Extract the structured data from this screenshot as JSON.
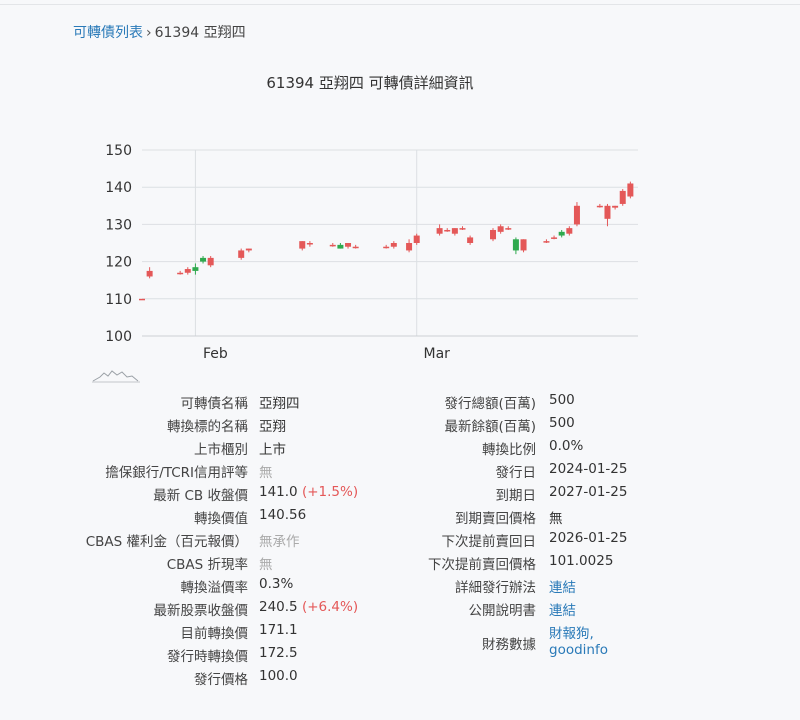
{
  "breadcrumb": {
    "parent": "可轉債列表",
    "separator": "›",
    "current": "61394 亞翔四"
  },
  "page_title": "61394 亞翔四 可轉債詳細資訊",
  "chart_data": {
    "type": "candlestick",
    "title": "",
    "ylim": [
      100,
      150
    ],
    "yticks": [
      "100",
      "110",
      "120",
      "130",
      "140",
      "150"
    ],
    "xtick_labels": [
      {
        "label": "Feb",
        "date": "2024-02-01"
      },
      {
        "label": "Mar",
        "date": "2024-03-01"
      }
    ],
    "x_range": [
      "2024-01-25",
      "2024-03-30"
    ],
    "colors": {
      "up": "#e45858",
      "down": "#2fa94e",
      "grid": "#dcdfe3"
    },
    "candles": [
      {
        "date": "2024-01-25",
        "o": 110.0,
        "h": 110.0,
        "l": 110.0,
        "c": 110.0
      },
      {
        "date": "2024-01-26",
        "o": 116.0,
        "h": 118.5,
        "l": 115.5,
        "c": 117.5
      },
      {
        "date": "2024-01-30",
        "o": 117.0,
        "h": 117.5,
        "l": 116.5,
        "c": 117.0
      },
      {
        "date": "2024-01-31",
        "o": 117.0,
        "h": 118.5,
        "l": 116.5,
        "c": 118.0
      },
      {
        "date": "2024-02-01",
        "o": 118.5,
        "h": 119.5,
        "l": 116.5,
        "c": 117.5
      },
      {
        "date": "2024-02-02",
        "o": 121.0,
        "h": 121.5,
        "l": 119.5,
        "c": 120.0
      },
      {
        "date": "2024-02-03",
        "o": 119.0,
        "h": 121.5,
        "l": 118.5,
        "c": 121.0
      },
      {
        "date": "2024-02-07",
        "o": 121.0,
        "h": 123.5,
        "l": 120.5,
        "c": 123.0
      },
      {
        "date": "2024-02-08",
        "o": 123.0,
        "h": 123.5,
        "l": 122.5,
        "c": 123.5
      },
      {
        "date": "2024-02-15",
        "o": 123.5,
        "h": 125.5,
        "l": 123.0,
        "c": 125.5
      },
      {
        "date": "2024-02-16",
        "o": 125.0,
        "h": 125.5,
        "l": 124.0,
        "c": 125.0
      },
      {
        "date": "2024-02-19",
        "o": 124.5,
        "h": 125.0,
        "l": 124.0,
        "c": 124.5
      },
      {
        "date": "2024-02-20",
        "o": 124.5,
        "h": 125.0,
        "l": 123.5,
        "c": 123.5
      },
      {
        "date": "2024-02-21",
        "o": 124.0,
        "h": 125.0,
        "l": 123.5,
        "c": 125.0
      },
      {
        "date": "2024-02-22",
        "o": 124.0,
        "h": 124.5,
        "l": 123.5,
        "c": 124.0
      },
      {
        "date": "2024-02-26",
        "o": 124.0,
        "h": 124.5,
        "l": 123.5,
        "c": 124.0
      },
      {
        "date": "2024-02-27",
        "o": 124.0,
        "h": 125.5,
        "l": 123.5,
        "c": 125.0
      },
      {
        "date": "2024-02-29",
        "o": 123.0,
        "h": 126.0,
        "l": 122.5,
        "c": 125.0
      },
      {
        "date": "2024-03-01",
        "o": 125.0,
        "h": 127.5,
        "l": 124.5,
        "c": 127.0
      },
      {
        "date": "2024-03-04",
        "o": 127.5,
        "h": 130.0,
        "l": 127.0,
        "c": 129.0
      },
      {
        "date": "2024-03-05",
        "o": 128.5,
        "h": 129.0,
        "l": 128.0,
        "c": 128.5
      },
      {
        "date": "2024-03-06",
        "o": 127.5,
        "h": 129.0,
        "l": 127.0,
        "c": 129.0
      },
      {
        "date": "2024-03-07",
        "o": 129.0,
        "h": 129.5,
        "l": 128.5,
        "c": 129.0
      },
      {
        "date": "2024-03-08",
        "o": 125.0,
        "h": 127.0,
        "l": 124.5,
        "c": 126.5
      },
      {
        "date": "2024-03-11",
        "o": 126.0,
        "h": 129.0,
        "l": 125.5,
        "c": 128.5
      },
      {
        "date": "2024-03-12",
        "o": 128.0,
        "h": 130.0,
        "l": 127.5,
        "c": 129.5
      },
      {
        "date": "2024-03-13",
        "o": 129.0,
        "h": 129.5,
        "l": 128.5,
        "c": 129.0
      },
      {
        "date": "2024-03-14",
        "o": 126.0,
        "h": 126.5,
        "l": 122.0,
        "c": 123.0
      },
      {
        "date": "2024-03-15",
        "o": 123.0,
        "h": 126.0,
        "l": 122.5,
        "c": 126.0
      },
      {
        "date": "2024-03-18",
        "o": 125.5,
        "h": 126.0,
        "l": 125.0,
        "c": 125.5
      },
      {
        "date": "2024-03-19",
        "o": 126.5,
        "h": 127.0,
        "l": 126.0,
        "c": 126.5
      },
      {
        "date": "2024-03-20",
        "o": 128.0,
        "h": 128.5,
        "l": 126.5,
        "c": 127.0
      },
      {
        "date": "2024-03-21",
        "o": 127.5,
        "h": 129.5,
        "l": 127.0,
        "c": 129.0
      },
      {
        "date": "2024-03-22",
        "o": 130.0,
        "h": 136.0,
        "l": 129.5,
        "c": 135.0
      },
      {
        "date": "2024-03-25",
        "o": 135.0,
        "h": 135.5,
        "l": 134.5,
        "c": 135.0
      },
      {
        "date": "2024-03-26",
        "o": 131.5,
        "h": 135.5,
        "l": 129.5,
        "c": 135.0
      },
      {
        "date": "2024-03-27",
        "o": 134.5,
        "h": 135.0,
        "l": 134.0,
        "c": 135.0
      },
      {
        "date": "2024-03-28",
        "o": 135.5,
        "h": 139.5,
        "l": 135.0,
        "c": 139.0
      },
      {
        "date": "2024-03-29",
        "o": 137.5,
        "h": 141.5,
        "l": 137.0,
        "c": 141.0
      }
    ]
  },
  "left_info": [
    {
      "label": "可轉債名稱",
      "value": "亞翔四"
    },
    {
      "label": "轉換標的名稱",
      "value": "亞翔"
    },
    {
      "label": "上市櫃別",
      "value": "上市"
    },
    {
      "label": "擔保銀行/TCRI信用評等",
      "value": "無",
      "style": "muted"
    },
    {
      "label": "最新 CB 收盤價",
      "value": "141.0",
      "change": "(+1.5%)"
    },
    {
      "label": "轉換價值",
      "value": "140.56"
    },
    {
      "label": "CBAS 權利金（百元報價）",
      "value": "無承作",
      "style": "muted"
    },
    {
      "label": "CBAS 折現率",
      "value": "無",
      "style": "muted"
    },
    {
      "label": "轉換溢價率",
      "value": "0.3%"
    },
    {
      "label": "最新股票收盤價",
      "value": "240.5",
      "change": "(+6.4%)"
    },
    {
      "label": "目前轉換價",
      "value": "171.1"
    },
    {
      "label": "發行時轉換價",
      "value": "172.5"
    },
    {
      "label": "發行價格",
      "value": "100.0"
    }
  ],
  "right_info": [
    {
      "label": "發行總額(百萬)",
      "value": "500"
    },
    {
      "label": "最新餘額(百萬)",
      "value": "500"
    },
    {
      "label": "轉換比例",
      "value": "0.0%"
    },
    {
      "label": "發行日",
      "value": "2024-01-25"
    },
    {
      "label": "到期日",
      "value": "2027-01-25"
    },
    {
      "label": "到期賣回價格",
      "value": "無"
    },
    {
      "label": "下次提前賣回日",
      "value": "2026-01-25"
    },
    {
      "label": "下次提前賣回價格",
      "value": "101.0025"
    },
    {
      "label": "詳細發行辦法",
      "value": "連結",
      "style": "link"
    },
    {
      "label": "公開說明書",
      "value": "連結",
      "style": "link"
    },
    {
      "label": "財務數據",
      "value": "財報狗,",
      "value2": "goodinfo",
      "style": "link"
    }
  ]
}
